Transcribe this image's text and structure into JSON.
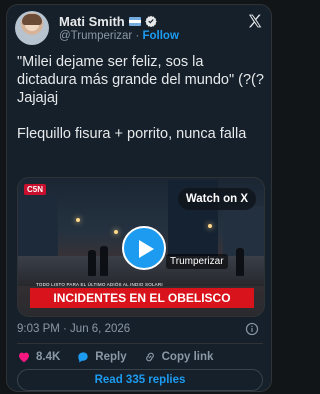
{
  "author": {
    "name": "Mati Smith",
    "handle": "@Trumperizar",
    "separator": "·",
    "follow_label": "Follow"
  },
  "tweet": {
    "lines": [
      "\"Milei dejame ser feliz, sos la dictadura más grande del mundo\" (?(? Jajajaj",
      "Flequillo fisura + porrito, nunca falla"
    ]
  },
  "media": {
    "watch_label": "Watch on X",
    "owner_tag": "Trumperizar",
    "channel_logo": "C5N",
    "ticker": "TODO LISTO PARA EL ÚLTIMO ADIÓS AL INDIO SOLARI",
    "banner": "INCIDENTES EN EL OBELISCO"
  },
  "meta": {
    "timestamp": "9:03 PM · Jun 6, 2026"
  },
  "actions": {
    "likes": "8.4K",
    "reply_label": "Reply",
    "copy_link_label": "Copy link"
  },
  "read_replies_label": "Read 335 replies",
  "colors": {
    "accent": "#1d9bf0",
    "like": "#f91880",
    "banner": "#d8131b",
    "card_bg": "#15202b"
  },
  "icons": [
    "verified-badge-icon",
    "argentina-flag-icon",
    "x-logo-icon",
    "play-icon",
    "info-icon",
    "heart-icon",
    "reply-icon",
    "link-icon"
  ]
}
